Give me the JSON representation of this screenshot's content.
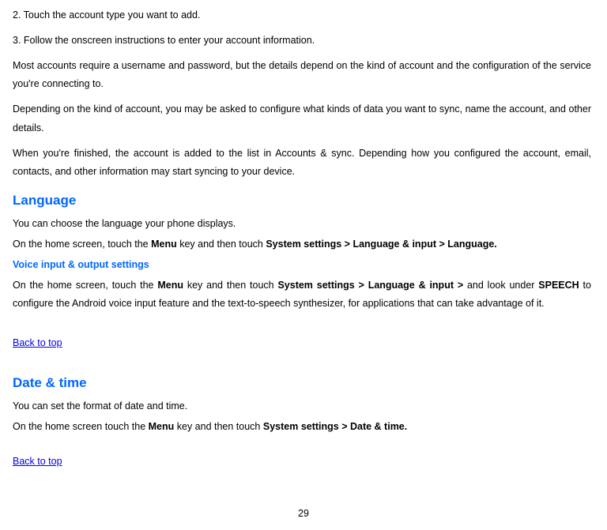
{
  "steps": {
    "step2": "2. Touch the account type you want to add.",
    "step3": "3. Follow the onscreen instructions to enter your account information."
  },
  "accounts": {
    "p1": "Most accounts require a username and password, but the details depend on the kind of account and the configuration of the service you're connecting to.",
    "p2": "Depending on the kind of account, you may be asked to configure what kinds of data you want to sync, name the account, and other details.",
    "p3": "When you're finished, the account is added to the list in Accounts & sync. Depending how you configured the account, email, contacts, and other information may start syncing to your device."
  },
  "language": {
    "heading": "Language",
    "p1": "You can choose the language your phone displays.",
    "p2_pre": "On the home screen, touch the ",
    "p2_menu": "Menu",
    "p2_mid": " key and then touch ",
    "p2_bold": "System settings > Language & input > Language.",
    "voice_heading": "Voice input & output settings",
    "voice_p_pre": "On the home screen, touch the ",
    "voice_menu": "Menu",
    "voice_mid": " key and then touch ",
    "voice_path": "System settings > Language & input > ",
    "voice_mid2": "and look under ",
    "voice_speech": "SPEECH",
    "voice_end": " to configure the Android voice input feature and the text-to-speech synthesizer, for applications that can take advantage of it."
  },
  "back_to_top": "Back to top",
  "datetime": {
    "heading": "Date & time",
    "p1": "You can set the format of date and time.",
    "p2_pre": "On the home screen touch the ",
    "p2_menu": "Menu",
    "p2_mid": " key and then touch ",
    "p2_bold": "System settings > Date & time."
  },
  "page_number": "29"
}
